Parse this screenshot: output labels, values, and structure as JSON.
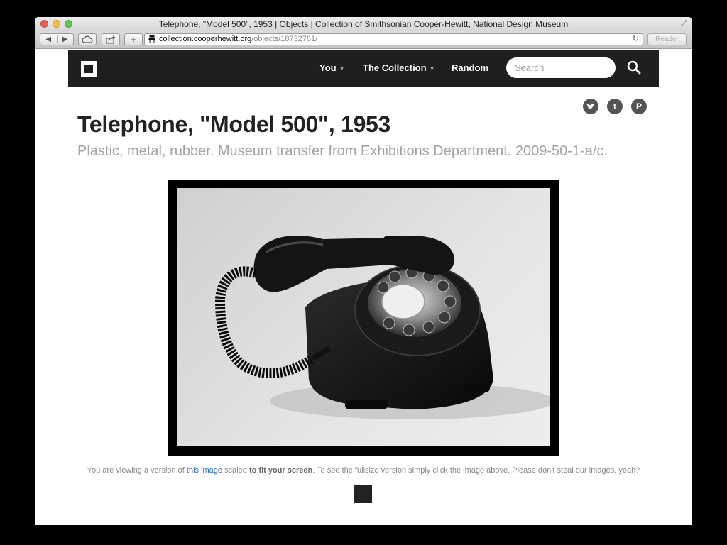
{
  "window": {
    "title": "Telephone, \"Model 500\", 1953 | Objects | Collection of Smithsonian Cooper-Hewitt, National Design Museum"
  },
  "toolbar": {
    "back_glyph": "◀",
    "forward_glyph": "▶",
    "new_tab_glyph": "+",
    "url_domain": "collection.cooperhewitt.org",
    "url_path": "/objects/18732761/",
    "reload_glyph": "↻",
    "reader_label": "Reader"
  },
  "nav": {
    "items": [
      {
        "label": "You",
        "has_dropdown": true
      },
      {
        "label": "The Collection",
        "has_dropdown": true
      },
      {
        "label": "Random",
        "has_dropdown": false
      }
    ],
    "caret_glyph": "▼",
    "search_placeholder": "Search"
  },
  "social": {
    "twitter_glyph": "🐦",
    "tumblr_glyph": "t",
    "pinterest_glyph": "P"
  },
  "object": {
    "title": "Telephone, \"Model 500\", 1953",
    "details": "Plastic, metal, rubber. Museum transfer from Exhibitions Department. 2009-50-1-a/c."
  },
  "caption": {
    "prefix": "You are viewing a version of ",
    "link": "this image",
    "middle": " scaled ",
    "bold": "to fit your screen",
    "suffix": ". To see the fullsize version simply click the image above. Please don't steal our images, yeah?"
  },
  "colors": {
    "nav_background": "#1f1f1f",
    "link": "#2a6ebb",
    "subtitle": "#a3a3a3"
  }
}
